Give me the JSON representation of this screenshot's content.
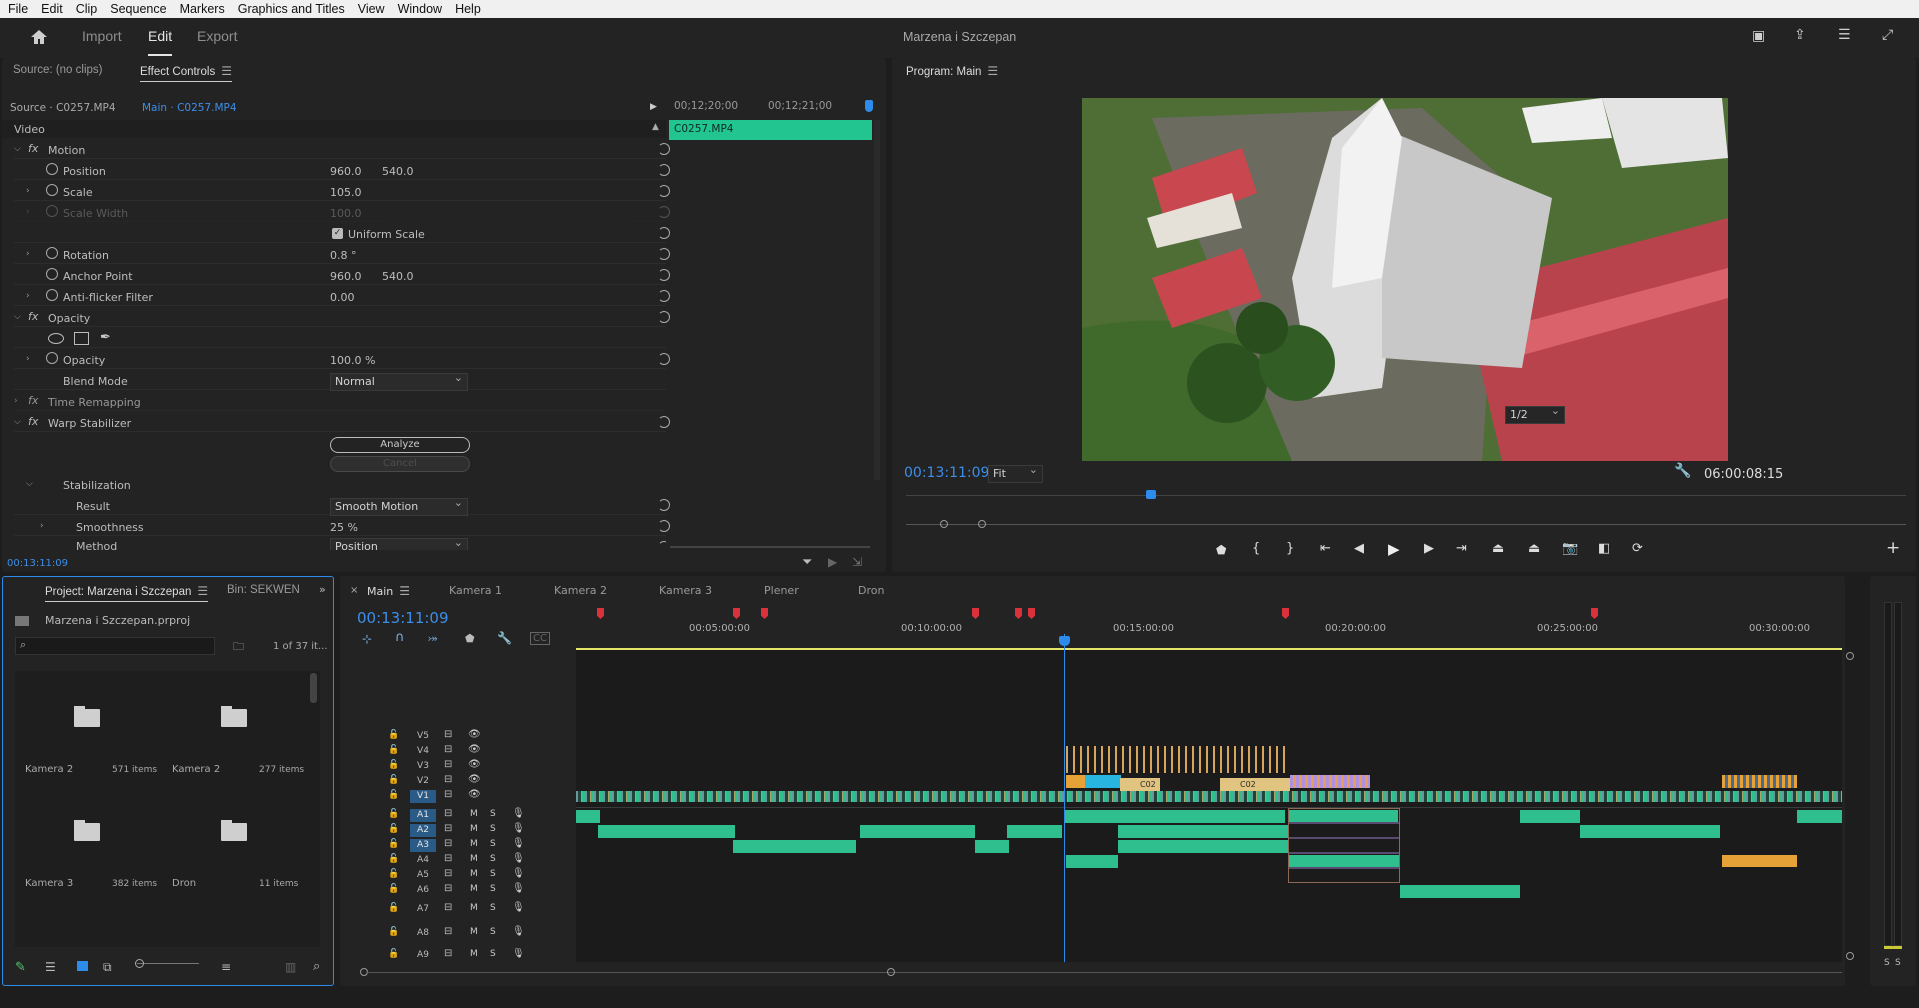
{
  "menu": [
    "File",
    "Edit",
    "Clip",
    "Sequence",
    "Markers",
    "Graphics and Titles",
    "View",
    "Window",
    "Help"
  ],
  "workspaces": {
    "import": "Import",
    "edit": "Edit",
    "export": "Export"
  },
  "project_title": "Marzena i Szczepan",
  "source_panel": {
    "tab_source": "Source: (no clips)",
    "tab_effect": "Effect Controls",
    "master": "Source · C0257.MP4",
    "clip_link": "Main · C0257.MP4",
    "tc_a": "00;12;20;00",
    "tc_b": "00;12;21;00",
    "clip_bar": "C0257.MP4",
    "section_video": "Video",
    "motion": "Motion",
    "position_lbl": "Position",
    "position_x": "960.0",
    "position_y": "540.0",
    "scale_lbl": "Scale",
    "scale_val": "105.0",
    "scalewidth_lbl": "Scale Width",
    "scalewidth_val": "100.0",
    "uniform": "Uniform Scale",
    "rotation_lbl": "Rotation",
    "rotation_val": "0.8 °",
    "anchor_lbl": "Anchor Point",
    "anchor_x": "960.0",
    "anchor_y": "540.0",
    "flicker_lbl": "Anti-flicker Filter",
    "flicker_val": "0.00",
    "opacity_fx": "Opacity",
    "opacity_lbl": "Opacity",
    "opacity_val": "100.0 %",
    "blend_lbl": "Blend Mode",
    "blend_val": "Normal",
    "time_remap": "Time Remapping",
    "warp": "Warp Stabilizer",
    "analyze": "Analyze",
    "cancel": "Cancel",
    "stabilization": "Stabilization",
    "result_lbl": "Result",
    "result_val": "Smooth Motion",
    "smooth_lbl": "Smoothness",
    "smooth_val": "25 %",
    "method_lbl": "Method",
    "method_val": "Position",
    "bottom_tc": "00:13:11:09"
  },
  "program": {
    "tab": "Program: Main",
    "tc": "00:13:11:09",
    "fit": "Fit",
    "quality": "1/2",
    "duration": "06:00:08:15"
  },
  "project": {
    "tab_project": "Project: Marzena i Szczepan",
    "tab_bin": "Bin: SEKWENC",
    "file": "Marzena i Szczepan.prproj",
    "count": "1 of 37 it...",
    "items": [
      {
        "name": "Kamera 2",
        "count": "571 items"
      },
      {
        "name": "Kamera 2",
        "count": "277 items"
      },
      {
        "name": "Kamera 3",
        "count": "382 items"
      },
      {
        "name": "Dron",
        "count": "11 items"
      }
    ]
  },
  "timeline": {
    "tabs": [
      "Main",
      "Kamera 1",
      "Kamera 2",
      "Kamera 3",
      "Plener",
      "Dron"
    ],
    "tc": "00:13:11:09",
    "ruler": [
      "00:05:00:00",
      "00:10:00:00",
      "00:15:00:00",
      "00:20:00:00",
      "00:25:00:00",
      "00:30:00:00"
    ],
    "video_tracks": [
      "V5",
      "V4",
      "V3",
      "V2",
      "V1"
    ],
    "audio_tracks": [
      "A1",
      "A2",
      "A3",
      "A4",
      "A5",
      "A6",
      "A7",
      "A8",
      "A9"
    ],
    "clip_labels": [
      "C02",
      "C02"
    ],
    "meter_labels": [
      "S",
      "S"
    ]
  },
  "colors": {
    "accent": "#2d8ceb",
    "clip_green": "#2fbf8f",
    "marker_red": "#d9323c"
  }
}
